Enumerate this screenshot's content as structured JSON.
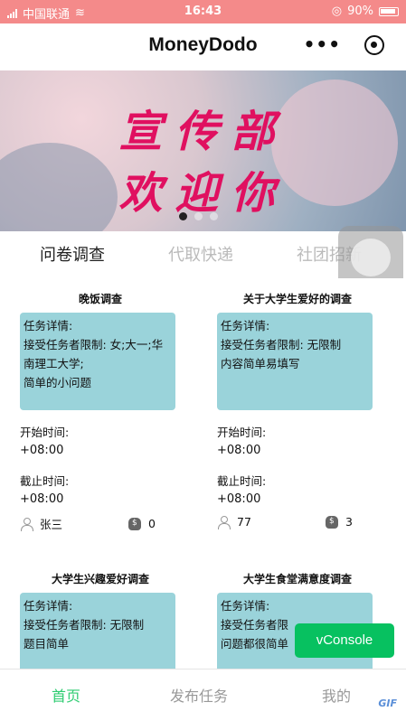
{
  "status_bar": {
    "carrier": "中国联通",
    "time": "16:43",
    "battery": "90%"
  },
  "nav": {
    "title": "MoneyDodo",
    "more_icon": "more-dots-icon",
    "close_icon": "target-circle-icon"
  },
  "banner": {
    "line1": "宣传部",
    "line2": "欢迎你",
    "slide_count": 3,
    "active_slide": 1
  },
  "tabs": [
    {
      "label": "问卷调查",
      "active": true
    },
    {
      "label": "代取快递",
      "active": false
    },
    {
      "label": "社团招新",
      "active": false
    }
  ],
  "cards": [
    {
      "title": "晚饭调查",
      "detail_heading": "任务详情:",
      "detail_lines": [
        "接受任务者限制: 女;大一;华",
        "南理工大学;",
        "简单的小问题"
      ],
      "start_label": "开始时间:",
      "start_value": "+08:00",
      "end_label": "截止时间:",
      "end_value": "+08:00",
      "publisher": "张三",
      "reward": "0"
    },
    {
      "title": "关于大学生爱好的调查",
      "detail_heading": "任务详情:",
      "detail_lines": [
        "接受任务者限制: 无限制",
        "内容简单易填写",
        ""
      ],
      "start_label": "开始时间:",
      "start_value": "+08:00",
      "end_label": "截止时间:",
      "end_value": "+08:00",
      "publisher": "77",
      "reward": "3"
    },
    {
      "title": "大学生兴趣爱好调查",
      "detail_heading": "任务详情:",
      "detail_lines": [
        "接受任务者限制: 无限制",
        "题目简单",
        ""
      ]
    },
    {
      "title": "大学生食堂满意度调查",
      "detail_heading": "任务详情:",
      "detail_lines": [
        "接受任务者限",
        "问题都很简单",
        ""
      ]
    }
  ],
  "vconsole_label": "vConsole",
  "tabbar": [
    {
      "label": "首页",
      "active": true
    },
    {
      "label": "发布任务",
      "active": false
    },
    {
      "label": "我的",
      "active": false
    }
  ],
  "watermark": "GIF"
}
